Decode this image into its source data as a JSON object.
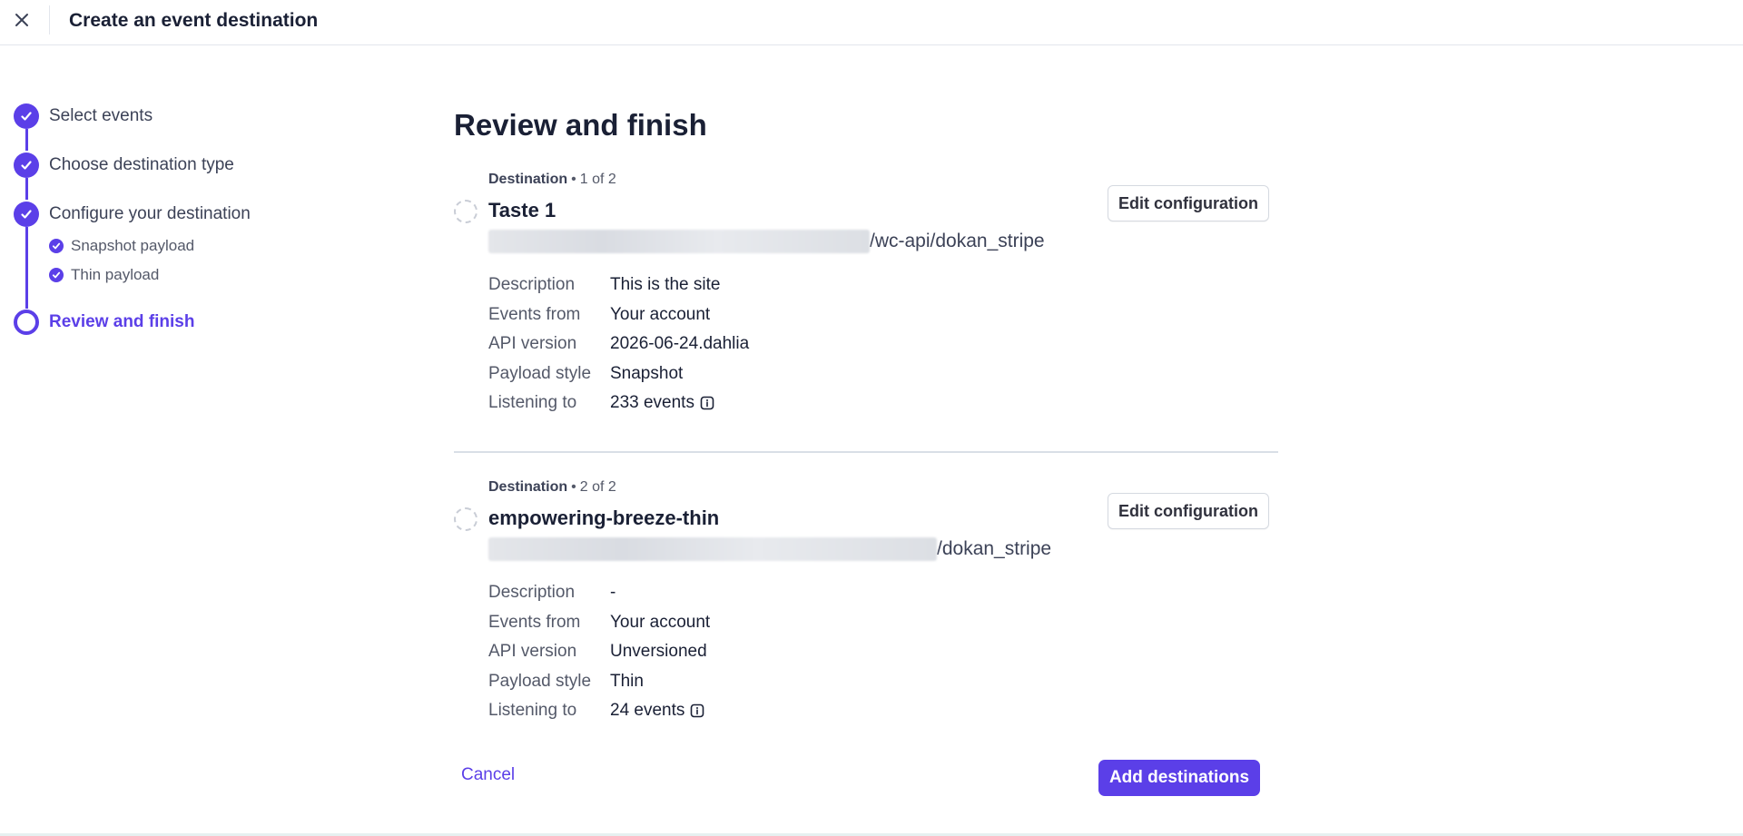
{
  "header": {
    "title": "Create an event destination",
    "close_icon": "close-icon"
  },
  "steps": [
    {
      "label": "Select events",
      "state": "done"
    },
    {
      "label": "Choose destination type",
      "state": "done"
    },
    {
      "label": "Configure your destination",
      "state": "done",
      "substeps": [
        {
          "label": "Snapshot payload",
          "state": "done"
        },
        {
          "label": "Thin payload",
          "state": "done"
        }
      ]
    },
    {
      "label": "Review and finish",
      "state": "current"
    }
  ],
  "main": {
    "title": "Review and finish",
    "destinations": [
      {
        "meta_label": "Destination",
        "meta_count": "1 of 2",
        "name": "Taste 1",
        "url_visible": "/wc-api/dokan_stripe",
        "edit_label": "Edit configuration",
        "props": [
          {
            "key": "Description",
            "value": "This is the site"
          },
          {
            "key": "Events from",
            "value": "Your account"
          },
          {
            "key": "API version",
            "value": "2026-06-24.dahlia"
          },
          {
            "key": "Payload style",
            "value": "Snapshot"
          },
          {
            "key": "Listening to",
            "value": "233 events",
            "info": true
          }
        ]
      },
      {
        "meta_label": "Destination",
        "meta_count": "2 of 2",
        "name": "empowering-breeze-thin",
        "url_visible": "/dokan_stripe",
        "edit_label": "Edit configuration",
        "props": [
          {
            "key": "Description",
            "value": "-"
          },
          {
            "key": "Events from",
            "value": "Your account"
          },
          {
            "key": "API version",
            "value": "Unversioned"
          },
          {
            "key": "Payload style",
            "value": "Thin"
          },
          {
            "key": "Listening to",
            "value": "24 events",
            "info": true
          }
        ]
      }
    ]
  },
  "footer": {
    "cancel_label": "Cancel",
    "add_label": "Add destinations"
  },
  "colors": {
    "accent": "#5b3fe8",
    "text": "#1a2035",
    "muted": "#545969"
  }
}
